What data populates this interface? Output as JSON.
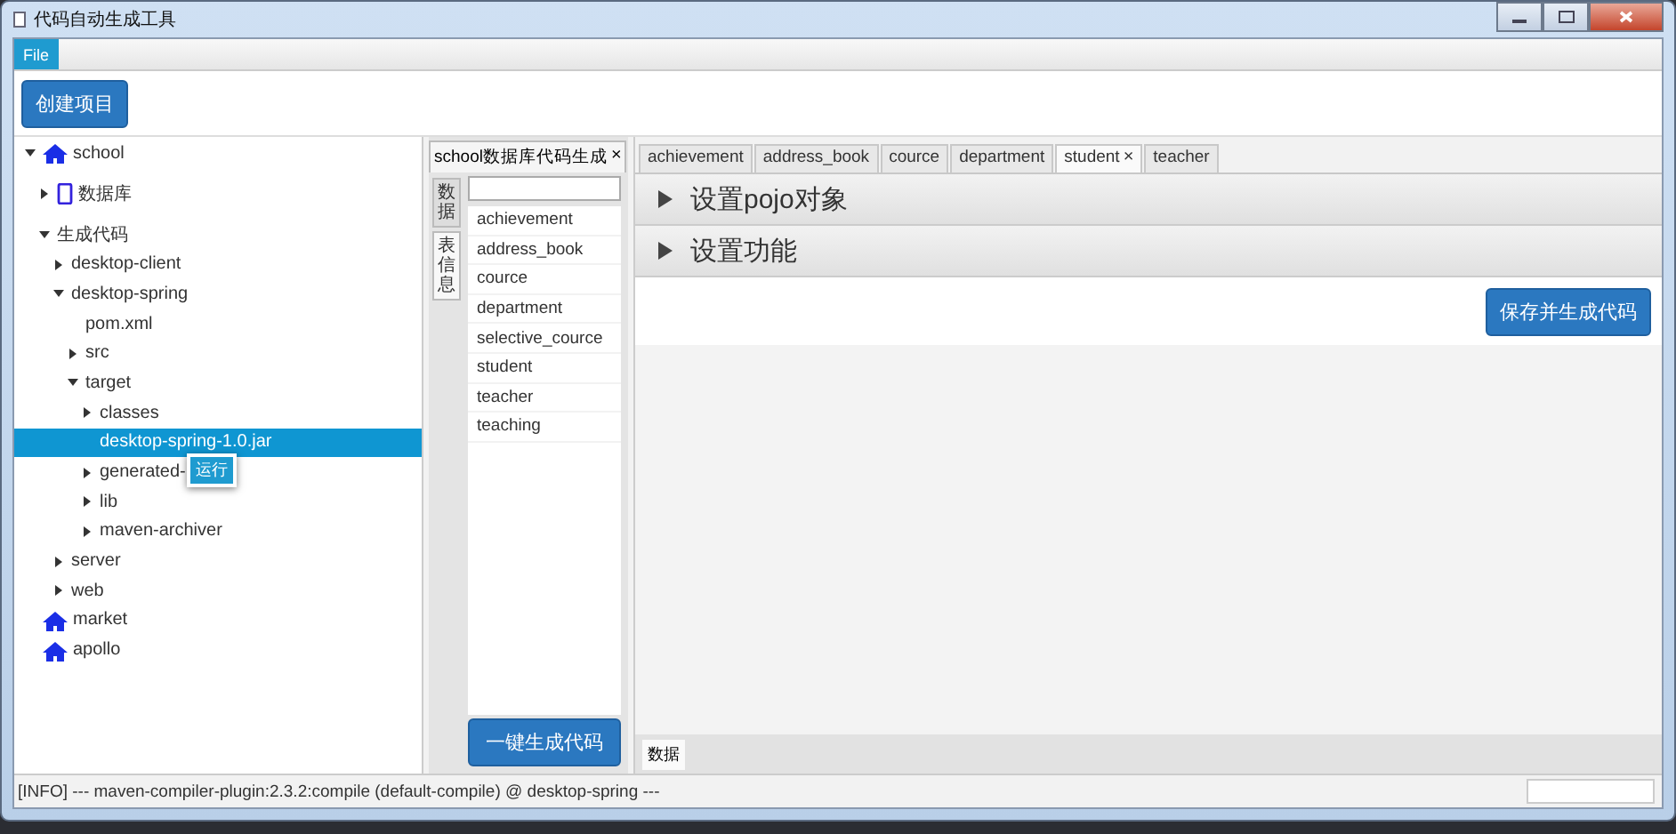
{
  "window": {
    "title": "代码自动生成工具"
  },
  "menu": [
    {
      "label": "File",
      "selected": true
    }
  ],
  "toolbar": {
    "create_button": "创建项目"
  },
  "tree": [
    {
      "label": "school",
      "kind": "house",
      "expanded": true,
      "selected": false,
      "children": [
        {
          "label": "数据库",
          "kind": "device",
          "expanded": false,
          "selected": false
        },
        {
          "label": "生成代码",
          "expanded": true,
          "selected": false,
          "children": [
            {
              "label": "desktop-client",
              "expanded": false,
              "selected": false
            },
            {
              "label": "desktop-spring",
              "expanded": true,
              "selected": false,
              "children": [
                {
                  "label": "pom.xml",
                  "selected": false
                },
                {
                  "label": "src",
                  "expanded": false,
                  "selected": false
                },
                {
                  "label": "target",
                  "expanded": true,
                  "selected": false,
                  "children": [
                    {
                      "label": "classes",
                      "expanded": false,
                      "selected": false
                    },
                    {
                      "label": "desktop-spring-1.0.jar",
                      "selected": true
                    },
                    {
                      "label": "generated-",
                      "expanded": false,
                      "selected": false
                    },
                    {
                      "label": "lib",
                      "expanded": false,
                      "selected": false
                    },
                    {
                      "label": "maven-archiver",
                      "expanded": false,
                      "selected": false
                    }
                  ]
                }
              ]
            },
            {
              "label": "server",
              "expanded": false,
              "selected": false
            },
            {
              "label": "web",
              "expanded": false,
              "selected": false
            }
          ]
        }
      ]
    },
    {
      "label": "market",
      "kind": "house",
      "selected": false
    },
    {
      "label": "apollo",
      "kind": "house",
      "selected": false
    }
  ],
  "context_menu": {
    "items": [
      "运行"
    ]
  },
  "doc_tab": {
    "label": "school数据库代码生成",
    "close": "×"
  },
  "side_tabs": [
    {
      "label": "数据",
      "selected": false
    },
    {
      "label": "表信息",
      "selected": true
    }
  ],
  "table_list": {
    "items": [
      "achievement",
      "address_book",
      "cource",
      "department",
      "selective_cource",
      "student",
      "teacher",
      "teaching"
    ],
    "button": "一键生成代码"
  },
  "table_tabs": [
    {
      "label": "achievement",
      "selected": false
    },
    {
      "label": "address_book",
      "selected": false
    },
    {
      "label": "cource",
      "selected": false
    },
    {
      "label": "department",
      "selected": false
    },
    {
      "label": "student",
      "selected": true,
      "close": "×"
    },
    {
      "label": "teacher",
      "selected": false
    }
  ],
  "sections": [
    {
      "title": "设置pojo对象",
      "expanded": false
    },
    {
      "title": "设置功能",
      "expanded": false
    }
  ],
  "save_button": "保存并生成代码",
  "bottom_tabs": [
    {
      "label": "数据",
      "selected": true
    }
  ],
  "status_bar": {
    "text": "[INFO] --- maven-compiler-plugin:2.3.2:compile (default-compile) @ desktop-spring ---"
  }
}
